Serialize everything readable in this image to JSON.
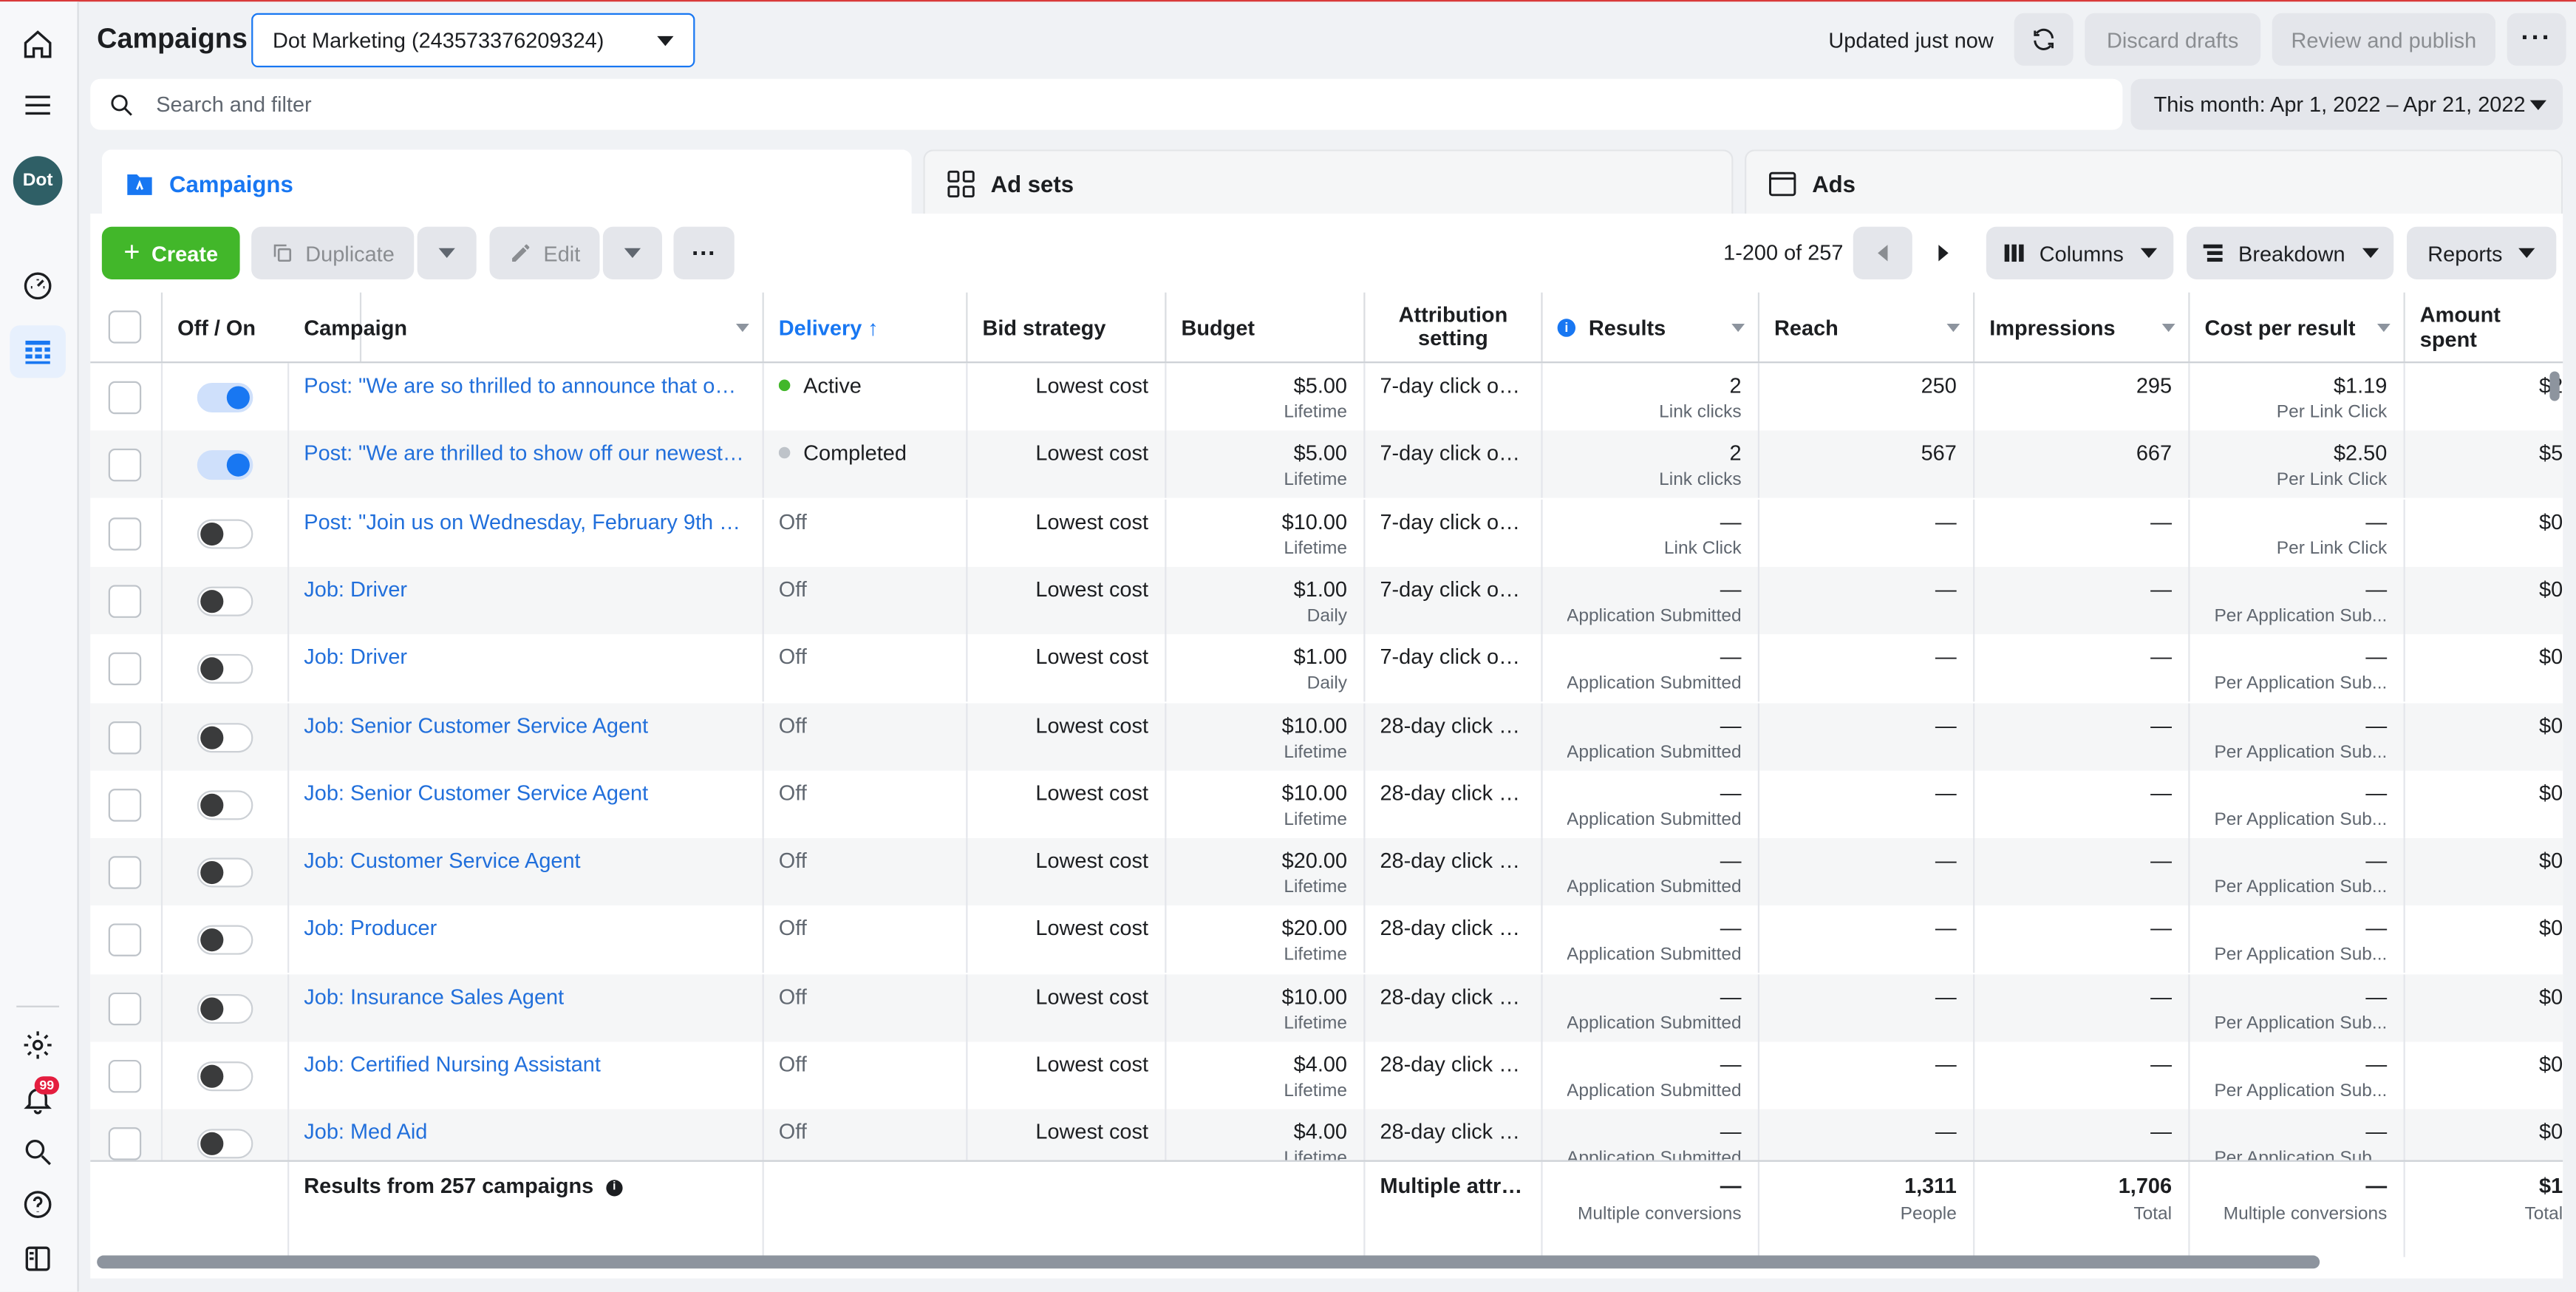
{
  "header": {
    "title": "Campaigns",
    "account": "Dot Marketing (243573376209324)",
    "updated": "Updated just now",
    "discard_label": "Discard drafts",
    "publish_label": "Review and publish",
    "avatar_text": "Dot"
  },
  "search": {
    "placeholder": "Search and filter"
  },
  "date_range": "This month: Apr 1, 2022 – Apr 21, 2022",
  "notifications": {
    "count": "99"
  },
  "tabs": [
    {
      "label": "Campaigns"
    },
    {
      "label": "Ad sets"
    },
    {
      "label": "Ads"
    }
  ],
  "toolbar": {
    "create": "Create",
    "duplicate": "Duplicate",
    "edit": "Edit",
    "page_count": "1-200 of 257",
    "columns": "Columns",
    "breakdown": "Breakdown",
    "reports": "Reports"
  },
  "columns": {
    "off_on": "Off / On",
    "campaign": "Campaign",
    "delivery": "Delivery ↑",
    "bid": "Bid strategy",
    "budget": "Budget",
    "attribution": "Attribution setting",
    "results": "Results",
    "reach": "Reach",
    "impressions": "Impressions",
    "cpr": "Cost per result",
    "spent": "Amount spent"
  },
  "rows": [
    {
      "on": true,
      "campaign": "Post: \"We are so thrilled to announce that our...",
      "delivery": "Active",
      "delivery_color": "#42b72a",
      "bid": "Lowest cost",
      "budget": "$5.00",
      "budget_type": "Lifetime",
      "attribution": "7-day click or ...",
      "results": "2",
      "results_sub": "Link clicks",
      "reach": "250",
      "impressions": "295",
      "cpr": "$1.19",
      "cpr_sub": "Per Link Click",
      "spent": "$2"
    },
    {
      "on": true,
      "campaign": "Post: \"We are thrilled to show off our newest ...",
      "delivery": "Completed",
      "delivery_color": "#bec3c9",
      "bid": "Lowest cost",
      "budget": "$5.00",
      "budget_type": "Lifetime",
      "attribution": "7-day click or ...",
      "results": "2",
      "results_sub": "Link clicks",
      "reach": "567",
      "impressions": "667",
      "cpr": "$2.50",
      "cpr_sub": "Per Link Click",
      "spent": "$5"
    },
    {
      "on": false,
      "campaign": "Post: \"Join us on Wednesday, February 9th to ...",
      "delivery": "Off",
      "bid": "Lowest cost",
      "budget": "$10.00",
      "budget_type": "Lifetime",
      "attribution": "7-day click or ...",
      "results": "—",
      "results_sub": "Link Click",
      "reach": "—",
      "impressions": "—",
      "cpr": "—",
      "cpr_sub": "Per Link Click",
      "spent": "$0"
    },
    {
      "on": false,
      "campaign": "Job: Driver",
      "delivery": "Off",
      "bid": "Lowest cost",
      "budget": "$1.00",
      "budget_type": "Daily",
      "attribution": "7-day click or ...",
      "results": "—",
      "results_sub": "Application Submitted",
      "reach": "—",
      "impressions": "—",
      "cpr": "—",
      "cpr_sub": "Per Application Sub...",
      "spent": "$0"
    },
    {
      "on": false,
      "campaign": "Job: Driver",
      "delivery": "Off",
      "bid": "Lowest cost",
      "budget": "$1.00",
      "budget_type": "Daily",
      "attribution": "7-day click or ...",
      "results": "—",
      "results_sub": "Application Submitted",
      "reach": "—",
      "impressions": "—",
      "cpr": "—",
      "cpr_sub": "Per Application Sub...",
      "spent": "$0"
    },
    {
      "on": false,
      "campaign": "Job: Senior Customer Service Agent",
      "delivery": "Off",
      "bid": "Lowest cost",
      "budget": "$10.00",
      "budget_type": "Lifetime",
      "attribution": "28-day click o...",
      "results": "—",
      "results_sub": "Application Submitted",
      "reach": "—",
      "impressions": "—",
      "cpr": "—",
      "cpr_sub": "Per Application Sub...",
      "spent": "$0"
    },
    {
      "on": false,
      "campaign": "Job: Senior Customer Service Agent",
      "delivery": "Off",
      "bid": "Lowest cost",
      "budget": "$10.00",
      "budget_type": "Lifetime",
      "attribution": "28-day click o...",
      "results": "—",
      "results_sub": "Application Submitted",
      "reach": "—",
      "impressions": "—",
      "cpr": "—",
      "cpr_sub": "Per Application Sub...",
      "spent": "$0"
    },
    {
      "on": false,
      "campaign": "Job: Customer Service Agent",
      "delivery": "Off",
      "bid": "Lowest cost",
      "budget": "$20.00",
      "budget_type": "Lifetime",
      "attribution": "28-day click o...",
      "results": "—",
      "results_sub": "Application Submitted",
      "reach": "—",
      "impressions": "—",
      "cpr": "—",
      "cpr_sub": "Per Application Sub...",
      "spent": "$0"
    },
    {
      "on": false,
      "campaign": "Job: Producer",
      "delivery": "Off",
      "bid": "Lowest cost",
      "budget": "$20.00",
      "budget_type": "Lifetime",
      "attribution": "28-day click o...",
      "results": "—",
      "results_sub": "Application Submitted",
      "reach": "—",
      "impressions": "—",
      "cpr": "—",
      "cpr_sub": "Per Application Sub...",
      "spent": "$0"
    },
    {
      "on": false,
      "campaign": "Job: Insurance Sales Agent",
      "delivery": "Off",
      "bid": "Lowest cost",
      "budget": "$10.00",
      "budget_type": "Lifetime",
      "attribution": "28-day click o...",
      "results": "—",
      "results_sub": "Application Submitted",
      "reach": "—",
      "impressions": "—",
      "cpr": "—",
      "cpr_sub": "Per Application Sub...",
      "spent": "$0"
    },
    {
      "on": false,
      "campaign": "Job: Certified Nursing Assistant",
      "delivery": "Off",
      "bid": "Lowest cost",
      "budget": "$4.00",
      "budget_type": "Lifetime",
      "attribution": "28-day click o...",
      "results": "—",
      "results_sub": "Application Submitted",
      "reach": "—",
      "impressions": "—",
      "cpr": "—",
      "cpr_sub": "Per Application Sub...",
      "spent": "$0"
    },
    {
      "on": false,
      "campaign": "Job: Med Aid",
      "delivery": "Off",
      "bid": "Lowest cost",
      "budget": "$4.00",
      "budget_type": "Lifetime",
      "attribution": "28-day click o...",
      "results": "—",
      "results_sub": "Application Submitted",
      "reach": "—",
      "impressions": "—",
      "cpr": "—",
      "cpr_sub": "Per Application Sub...",
      "spent": "$0"
    }
  ],
  "footer": {
    "label": "Results from 257 campaigns",
    "attribution": "Multiple attrib...",
    "results": "—",
    "results_sub": "Multiple conversions",
    "reach": "1,311",
    "reach_sub": "People",
    "impressions": "1,706",
    "impressions_sub": "Total",
    "cpr": "—",
    "cpr_sub": "Multiple conversions",
    "spent": "$1",
    "spent_sub": "Total"
  },
  "colors": {
    "accent": "#1877f2",
    "create_green": "#42b72a",
    "link": "#216fdb",
    "active_dot": "#42b72a"
  }
}
